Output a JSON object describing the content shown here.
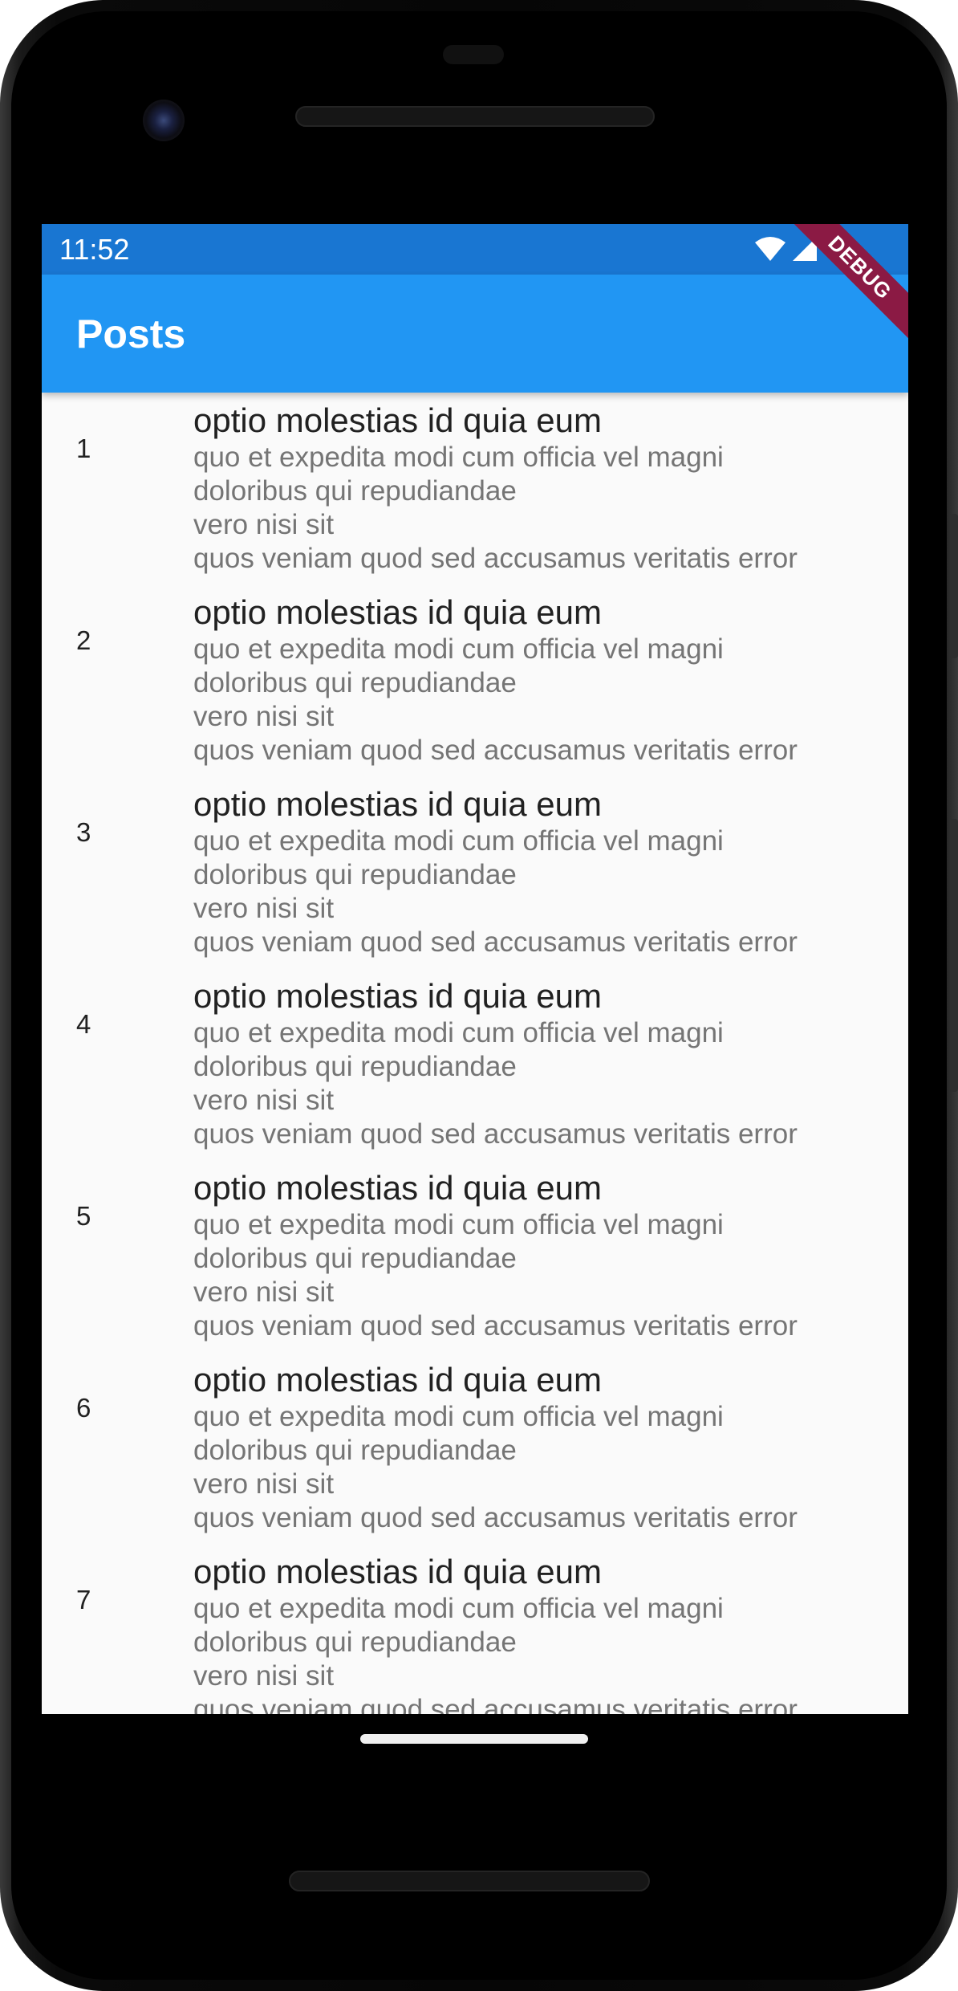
{
  "status_bar": {
    "time": "11:52",
    "icons": [
      "wifi-icon",
      "cell-signal-icon"
    ]
  },
  "app_bar": {
    "title": "Posts",
    "debug_banner": "DEBUG"
  },
  "colors": {
    "status_bar": "#1976d2",
    "app_bar": "#2196f3",
    "debug_banner": "#8b1a44",
    "background": "#fafafa",
    "title_text": "#212121",
    "body_text": "#757575"
  },
  "posts": [
    {
      "id": "1",
      "title": "optio molestias id quia eum",
      "body": "quo et expedita modi cum officia vel magni\ndoloribus qui repudiandae\nvero nisi sit\nquos veniam quod sed accusamus veritatis error"
    },
    {
      "id": "2",
      "title": "optio molestias id quia eum",
      "body": "quo et expedita modi cum officia vel magni\ndoloribus qui repudiandae\nvero nisi sit\nquos veniam quod sed accusamus veritatis error"
    },
    {
      "id": "3",
      "title": "optio molestias id quia eum",
      "body": "quo et expedita modi cum officia vel magni\ndoloribus qui repudiandae\nvero nisi sit\nquos veniam quod sed accusamus veritatis error"
    },
    {
      "id": "4",
      "title": "optio molestias id quia eum",
      "body": "quo et expedita modi cum officia vel magni\ndoloribus qui repudiandae\nvero nisi sit\nquos veniam quod sed accusamus veritatis error"
    },
    {
      "id": "5",
      "title": "optio molestias id quia eum",
      "body": "quo et expedita modi cum officia vel magni\ndoloribus qui repudiandae\nvero nisi sit\nquos veniam quod sed accusamus veritatis error"
    },
    {
      "id": "6",
      "title": "optio molestias id quia eum",
      "body": "quo et expedita modi cum officia vel magni\ndoloribus qui repudiandae\nvero nisi sit\nquos veniam quod sed accusamus veritatis error"
    },
    {
      "id": "7",
      "title": "optio molestias id quia eum",
      "body": "quo et expedita modi cum officia vel magni\ndoloribus qui repudiandae\nvero nisi sit\nquos veniam quod sed accusamus veritatis error"
    }
  ]
}
